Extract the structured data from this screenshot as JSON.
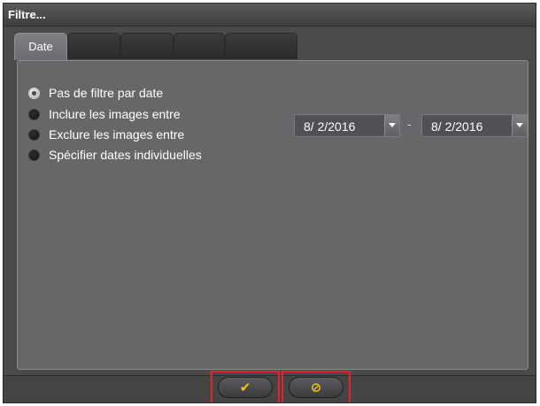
{
  "window": {
    "title": "Filtre..."
  },
  "tabs": [
    {
      "label": "Date",
      "active": true
    },
    {
      "label": "",
      "active": false
    },
    {
      "label": "",
      "active": false
    },
    {
      "label": "",
      "active": false
    },
    {
      "label": "",
      "active": false
    }
  ],
  "filter": {
    "options": [
      {
        "label": "Pas de filtre par date",
        "checked": true
      },
      {
        "label": "Inclure les images entre",
        "checked": false
      },
      {
        "label": "Exclure les images entre",
        "checked": false
      },
      {
        "label": "Spécifier dates individuelles",
        "checked": false
      }
    ],
    "date_from": "8/  2/2016",
    "date_separator": "-",
    "date_to": "8/  2/2016"
  },
  "buttons": {
    "ok_icon": "checkmark-icon",
    "ok_glyph": "✔",
    "cancel_icon": "cancel-circle-icon",
    "cancel_glyph": "⊘",
    "highlight_color": "#e0242b",
    "icon_color": "#f2c318"
  }
}
